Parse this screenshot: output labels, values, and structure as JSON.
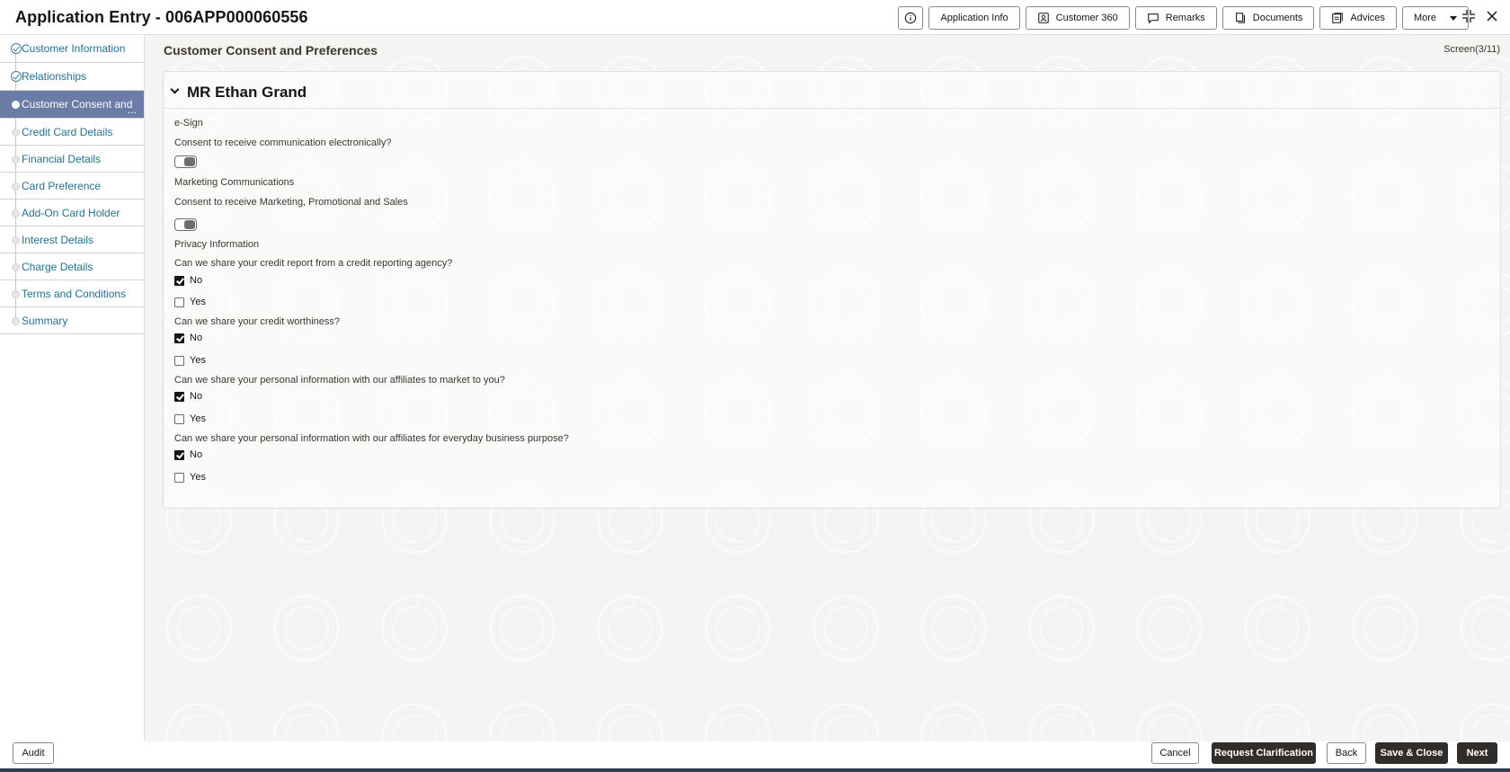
{
  "header": {
    "title": "Application Entry - 006APP000060556",
    "buttons": {
      "application_info": "Application Info",
      "customer_360": "Customer 360",
      "remarks": "Remarks",
      "documents": "Documents",
      "advices": "Advices",
      "more": "More"
    }
  },
  "sidebar": {
    "items": [
      {
        "label": "Customer Information",
        "state": "completed"
      },
      {
        "label": "Relationships",
        "state": "completed"
      },
      {
        "label": "Customer Consent and",
        "state": "active",
        "overflow": "..."
      },
      {
        "label": "Credit Card Details",
        "state": "pending"
      },
      {
        "label": "Financial Details",
        "state": "pending"
      },
      {
        "label": "Card Preference",
        "state": "pending"
      },
      {
        "label": "Add-On Card Holder",
        "state": "pending"
      },
      {
        "label": "Interest Details",
        "state": "pending"
      },
      {
        "label": "Charge Details",
        "state": "pending"
      },
      {
        "label": "Terms and Conditions",
        "state": "pending"
      },
      {
        "label": "Summary",
        "state": "pending"
      }
    ]
  },
  "main": {
    "title": "Customer Consent and Preferences",
    "screen_indicator": "Screen(3/11)",
    "customer_name": "MR Ethan Grand",
    "esign": {
      "section": "e-Sign",
      "question": "Consent to receive communication electronically?",
      "enabled": false
    },
    "marketing": {
      "section": "Marketing Communications",
      "question": "Consent to receive Marketing, Promotional and Sales",
      "enabled": false
    },
    "privacy": {
      "section": "Privacy Information",
      "questions": [
        {
          "text": "Can we share your credit report from a credit reporting agency?",
          "no": "No",
          "yes": "Yes",
          "no_checked": true,
          "yes_checked": false
        },
        {
          "text": "Can we share your credit worthiness?",
          "no": "No",
          "yes": "Yes",
          "no_checked": true,
          "yes_checked": false
        },
        {
          "text": "Can we share your personal information with our affiliates to market to you?",
          "no": "No",
          "yes": "Yes",
          "no_checked": true,
          "yes_checked": false
        },
        {
          "text": "Can we share your personal information with our affiliates for everyday business purpose?",
          "no": "No",
          "yes": "Yes",
          "no_checked": true,
          "yes_checked": false
        }
      ]
    }
  },
  "footer": {
    "audit": "Audit",
    "cancel": "Cancel",
    "request_clarification": "Request Clarification",
    "back": "Back",
    "save_close": "Save & Close",
    "next": "Next"
  },
  "colors": {
    "active_nav": "#6b7ca6",
    "link": "#227193",
    "primary_button": "#312d2a"
  }
}
